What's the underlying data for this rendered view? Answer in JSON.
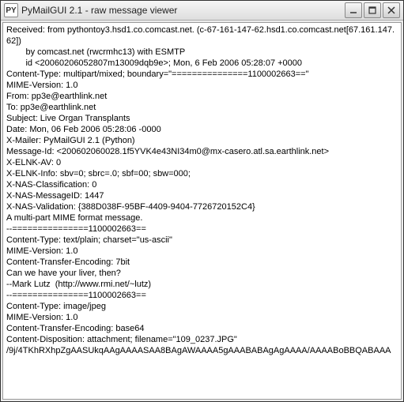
{
  "window": {
    "app_icon_text": "PY",
    "title": "PyMailGUI 2.1  - raw message viewer"
  },
  "raw_message_lines": [
    "Received: from pythontoy3.hsd1.co.comcast.net. (c-67-161-147-62.hsd1.co.comcast.net[67.161.147.62])",
    "        by comcast.net (rwcrmhc13) with ESMTP",
    "        id <20060206052807m13009dqb9e>; Mon, 6 Feb 2006 05:28:07 +0000",
    "Content-Type: multipart/mixed; boundary=\"===============1100002663==\"",
    "MIME-Version: 1.0",
    "From: pp3e@earthlink.net",
    "To: pp3e@earthlink.net",
    "Subject: Live Organ Transplants",
    "Date: Mon, 06 Feb 2006 05:28:06 -0000",
    "X-Mailer: PyMailGUI 2.1 (Python)",
    "Message-Id: <200602060028.1f5YVK4e43NI34m0@mx-casero.atl.sa.earthlink.net>",
    "X-ELNK-AV: 0",
    "X-ELNK-Info: sbv=0; sbrc=.0; sbf=00; sbw=000;",
    "X-NAS-Classification: 0",
    "X-NAS-MessageID: 1447",
    "X-NAS-Validation: {388D038F-95BF-4409-9404-7726720152C4}",
    "",
    "A multi-part MIME format message.",
    "",
    "--===============1100002663==",
    "Content-Type: text/plain; charset=\"us-ascii\"",
    "MIME-Version: 1.0",
    "Content-Transfer-Encoding: 7bit",
    "",
    "Can we have your liver, then?",
    "",
    "--Mark Lutz  (http://www.rmi.net/~lutz)",
    "",
    "--===============1100002663==",
    "Content-Type: image/jpeg",
    "MIME-Version: 1.0",
    "Content-Transfer-Encoding: base64",
    "Content-Disposition: attachment; filename=\"109_0237.JPG\"",
    "",
    "/9j/4TKhRXhpZgAASUkqAAgAAAASAA8BAgAWAAAA5gAAABABAgAgAAAA/AAAABoBBQABAAA"
  ]
}
